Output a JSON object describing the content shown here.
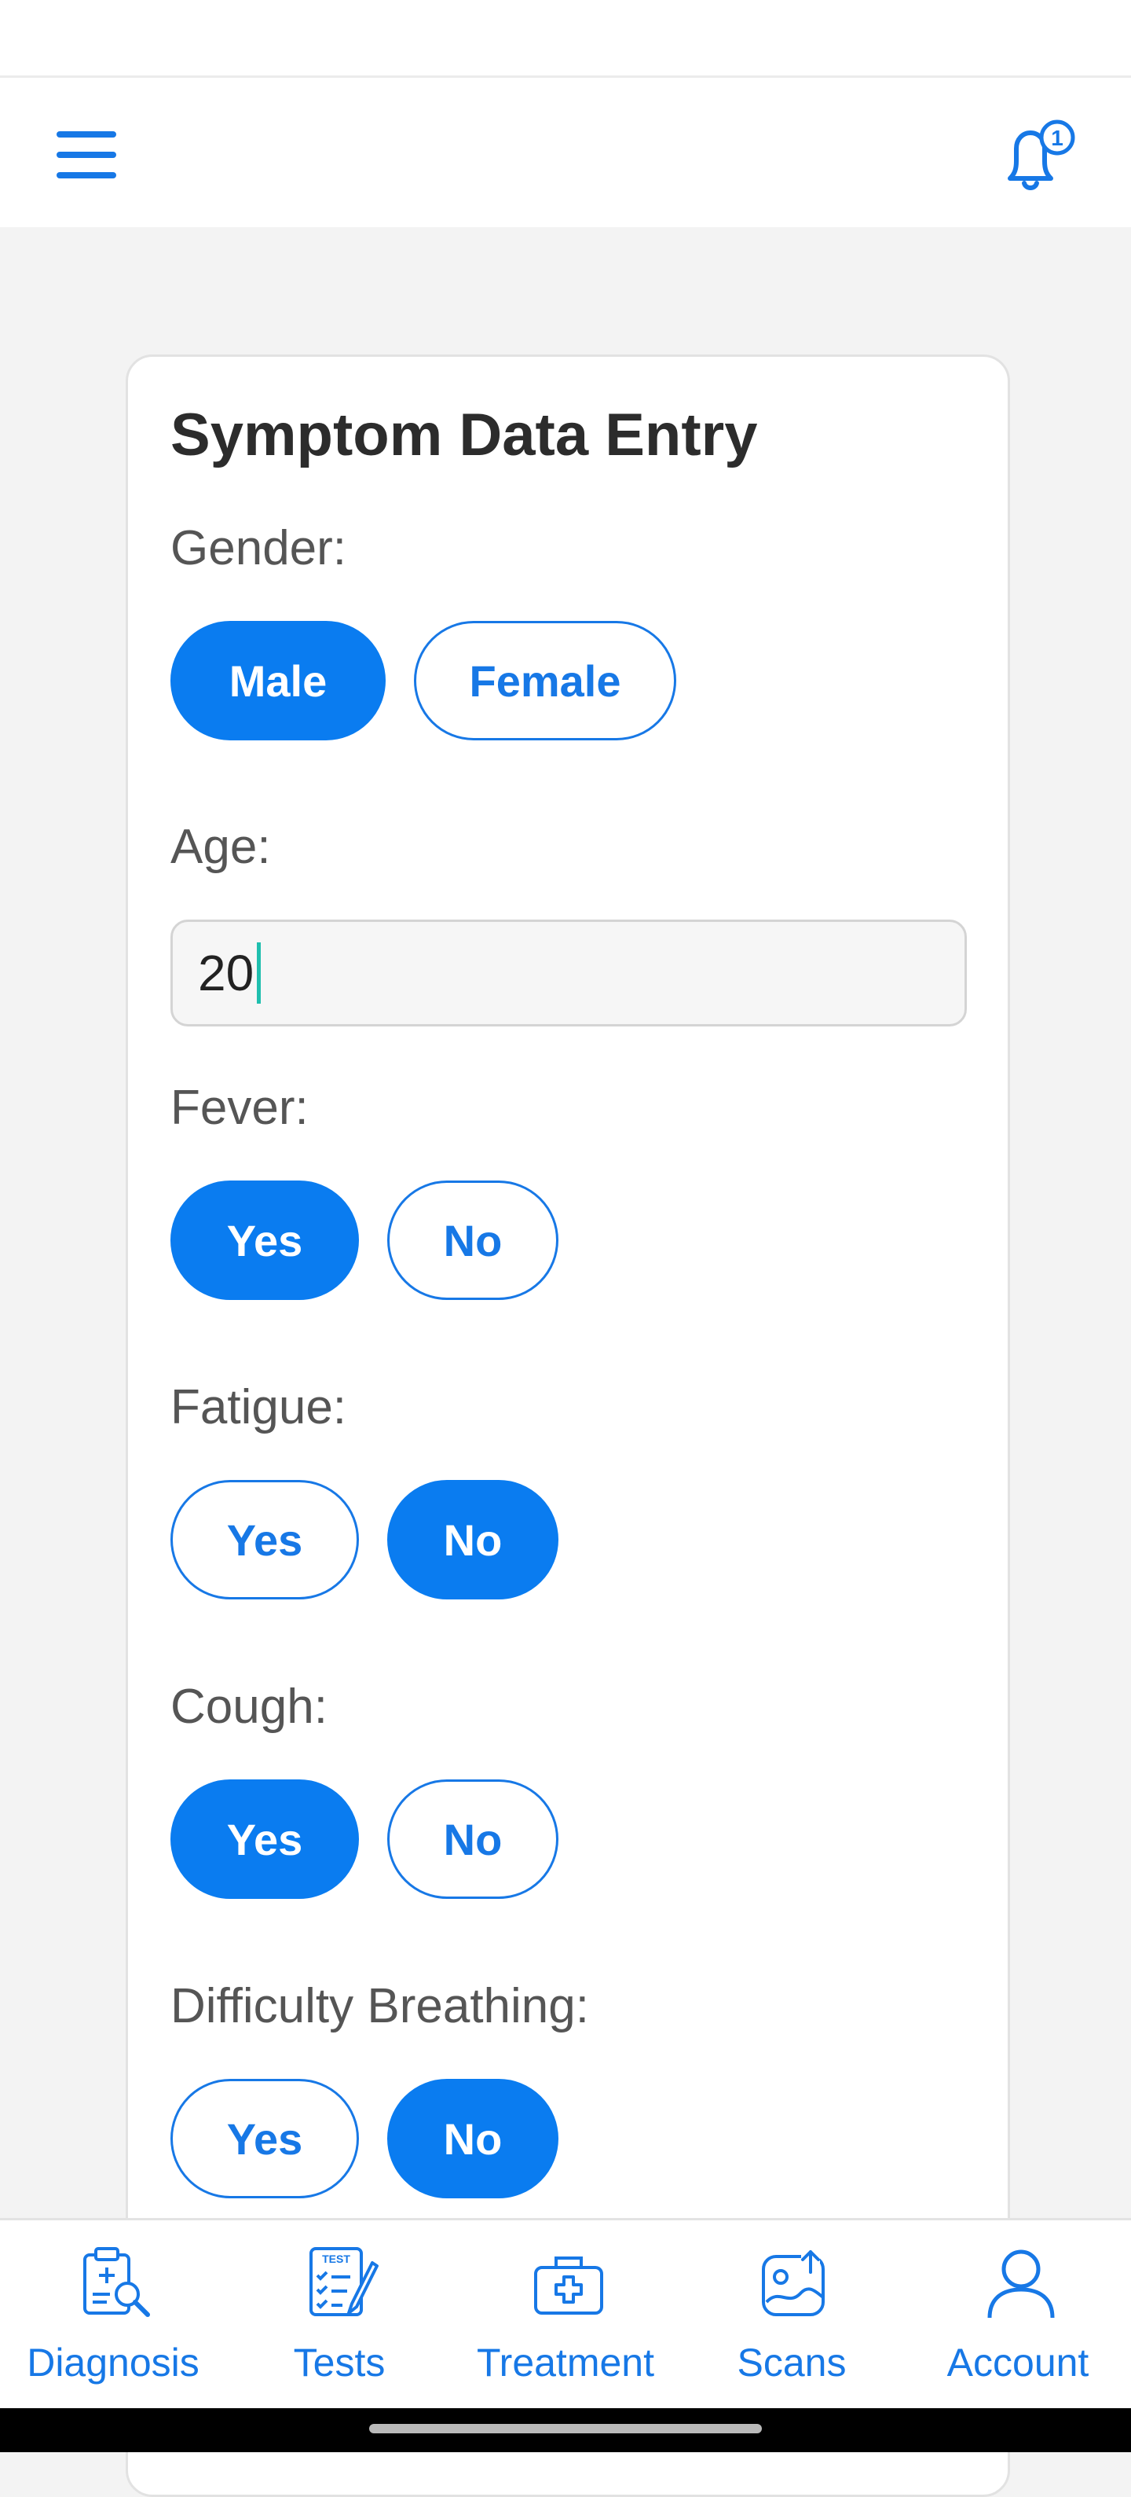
{
  "colors": {
    "accent": "#0a7cf0",
    "accent_text": "#1778e6",
    "card_bg": "#ffffff",
    "page_bg": "#f3f3f3"
  },
  "header": {
    "menu_icon": "hamburger-menu-icon",
    "bell_icon": "bell-icon",
    "notification_count": "1"
  },
  "form": {
    "title": "Symptom Data Entry",
    "gender": {
      "label": "Gender:",
      "options": [
        "Male",
        "Female"
      ],
      "selected": "Male"
    },
    "age": {
      "label": "Age:",
      "value": "20"
    },
    "fever": {
      "label": "Fever:",
      "options": [
        "Yes",
        "No"
      ],
      "selected": "Yes"
    },
    "fatigue": {
      "label": "Fatigue:",
      "options": [
        "Yes",
        "No"
      ],
      "selected": "No"
    },
    "cough": {
      "label": "Cough:",
      "options": [
        "Yes",
        "No"
      ],
      "selected": "Yes"
    },
    "difficulty_breathing": {
      "label": "Difficulty Breathing:",
      "options": [
        "Yes",
        "No"
      ],
      "selected": "No"
    }
  },
  "bottom_nav": {
    "items": [
      {
        "label": "Diagnosis",
        "icon": "clipboard-search-icon"
      },
      {
        "label": "Tests",
        "icon": "test-checklist-icon"
      },
      {
        "label": "Treatment",
        "icon": "medical-kit-icon"
      },
      {
        "label": "Scans",
        "icon": "scan-upload-icon"
      },
      {
        "label": "Account",
        "icon": "person-icon"
      }
    ]
  }
}
